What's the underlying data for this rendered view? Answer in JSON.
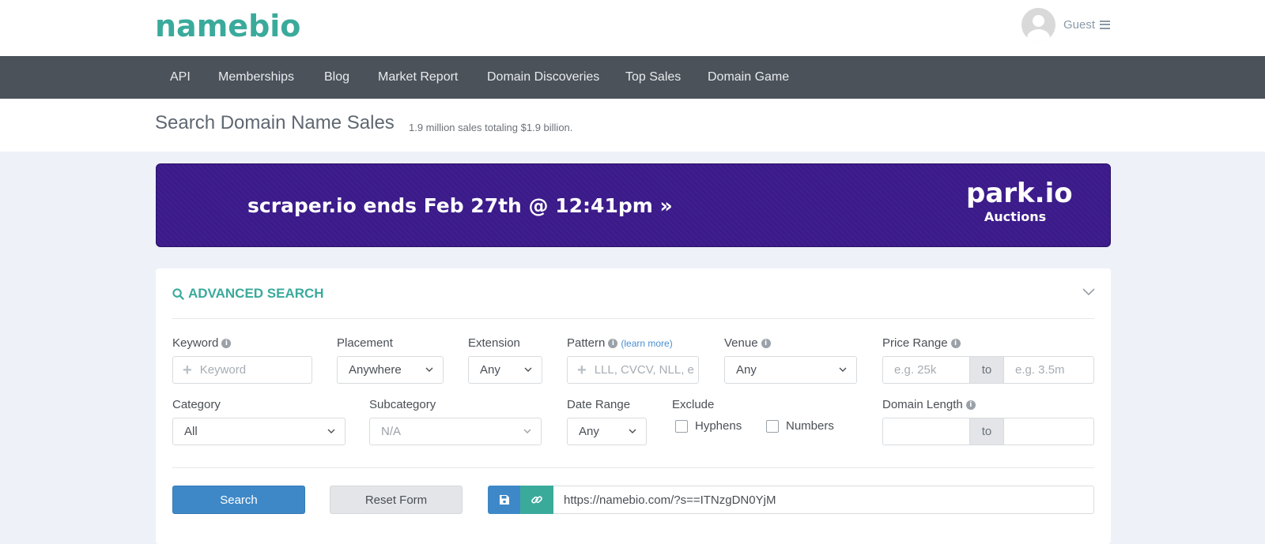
{
  "header": {
    "logo": "namebio",
    "user_name": "Guest"
  },
  "nav": {
    "items": [
      "API",
      "Memberships",
      "Blog",
      "Market Report",
      "Domain Discoveries",
      "Top Sales",
      "Domain Game"
    ]
  },
  "subheader": {
    "title": "Search Domain Name Sales",
    "subtitle": "1.9 million sales totaling $1.9 billion."
  },
  "banner": {
    "text": "scraper.io ends Feb 27th @ 12:41pm »",
    "brand_name": "park.io",
    "brand_sub": "Auctions",
    "bg_color": "#3b1a8a"
  },
  "search": {
    "header": "ADVANCED SEARCH",
    "keyword": {
      "label": "Keyword",
      "placeholder": "Keyword"
    },
    "placement": {
      "label": "Placement",
      "value": "Anywhere"
    },
    "extension": {
      "label": "Extension",
      "value": "Any"
    },
    "pattern": {
      "label": "Pattern",
      "learn_more": "(learn more)",
      "placeholder": "LLL, CVCV, NLL, e"
    },
    "venue": {
      "label": "Venue",
      "value": "Any"
    },
    "price_range": {
      "label": "Price Range",
      "min_placeholder": "e.g. 25k",
      "to": "to",
      "max_placeholder": "e.g. 3.5m"
    },
    "category": {
      "label": "Category",
      "value": "All"
    },
    "subcategory": {
      "label": "Subcategory",
      "value": "N/A"
    },
    "date_range": {
      "label": "Date Range",
      "value": "Any"
    },
    "exclude": {
      "label": "Exclude",
      "hyphens": "Hyphens",
      "numbers": "Numbers"
    },
    "domain_length": {
      "label": "Domain Length",
      "to": "to"
    },
    "buttons": {
      "search": "Search",
      "reset": "Reset Form"
    },
    "share_url": "https://namebio.com/?s==ITNzgDN0YjM"
  },
  "colors": {
    "accent": "#3aaa9b",
    "primary": "#3e88c8",
    "nav_bg": "#4b525a"
  }
}
